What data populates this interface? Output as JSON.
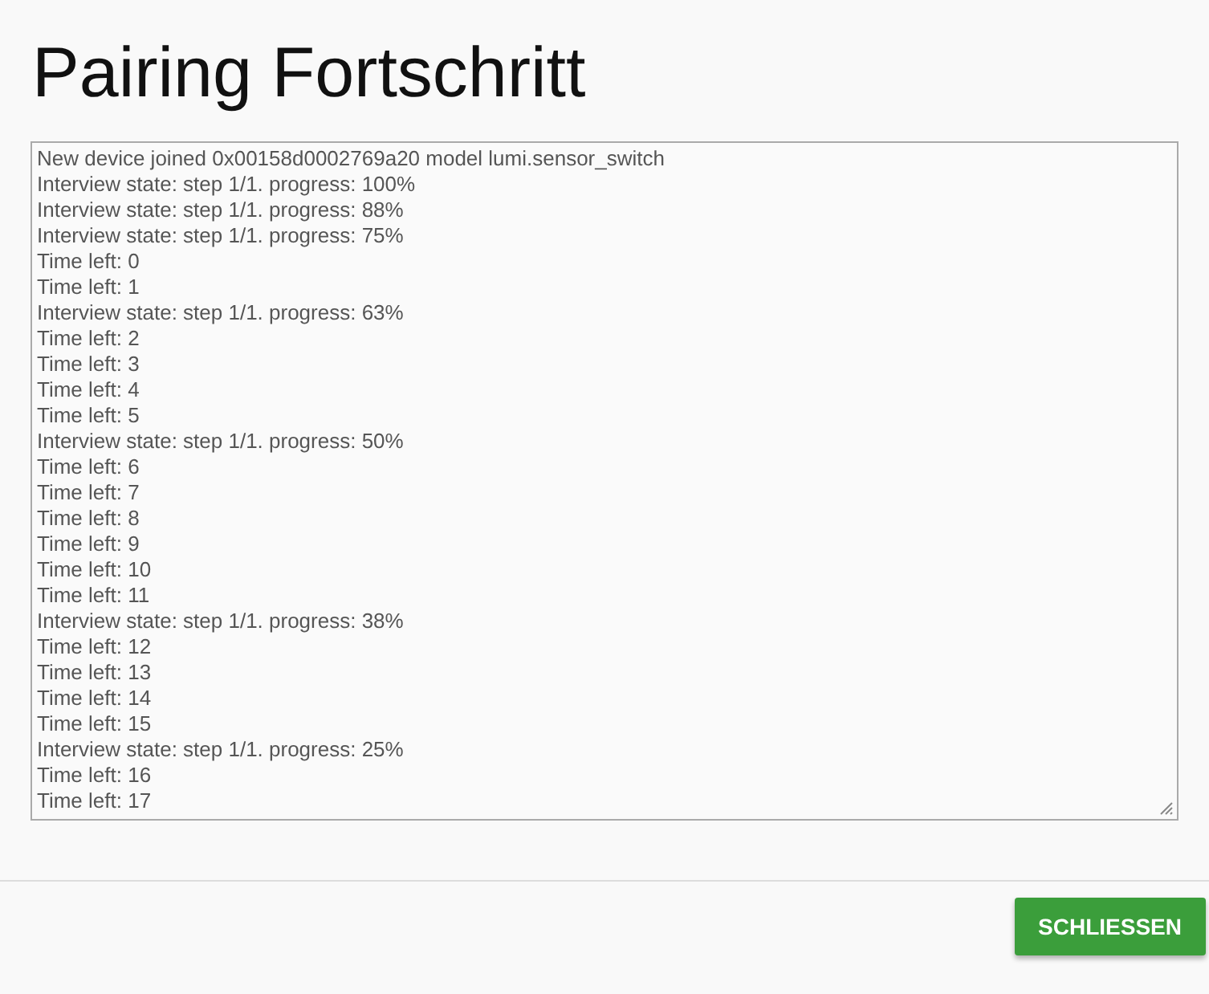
{
  "dialog": {
    "title": "Pairing Fortschritt"
  },
  "log": {
    "lines": [
      "New device joined 0x00158d0002769a20 model lumi.sensor_switch",
      "Interview state: step 1/1. progress: 100%",
      "Interview state: step 1/1. progress: 88%",
      "Interview state: step 1/1. progress: 75%",
      "Time left: 0",
      "Time left: 1",
      "Interview state: step 1/1. progress: 63%",
      "Time left: 2",
      "Time left: 3",
      "Time left: 4",
      "Time left: 5",
      "Interview state: step 1/1. progress: 50%",
      "Time left: 6",
      "Time left: 7",
      "Time left: 8",
      "Time left: 9",
      "Time left: 10",
      "Time left: 11",
      "Interview state: step 1/1. progress: 38%",
      "Time left: 12",
      "Time left: 13",
      "Time left: 14",
      "Time left: 15",
      "Interview state: step 1/1. progress: 25%",
      "Time left: 16",
      "Time left: 17"
    ]
  },
  "buttons": [
    {
      "label": "SCHLIESSEN"
    }
  ]
}
